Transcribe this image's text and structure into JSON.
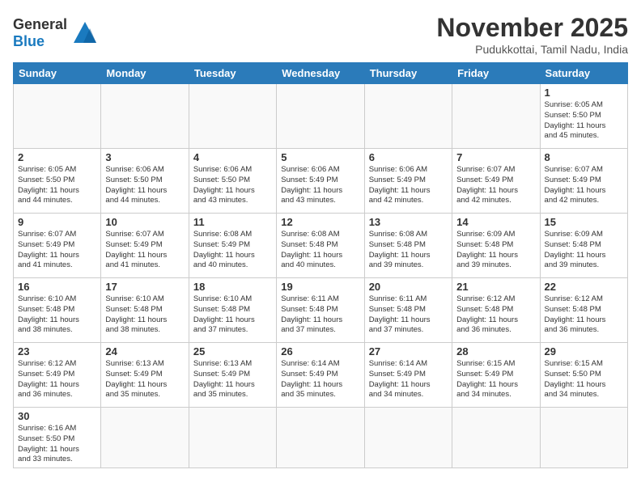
{
  "header": {
    "logo_general": "General",
    "logo_blue": "Blue",
    "month_title": "November 2025",
    "subtitle": "Pudukkottai, Tamil Nadu, India"
  },
  "days_of_week": [
    "Sunday",
    "Monday",
    "Tuesday",
    "Wednesday",
    "Thursday",
    "Friday",
    "Saturday"
  ],
  "weeks": [
    [
      {
        "day": null,
        "info": null
      },
      {
        "day": null,
        "info": null
      },
      {
        "day": null,
        "info": null
      },
      {
        "day": null,
        "info": null
      },
      {
        "day": null,
        "info": null
      },
      {
        "day": null,
        "info": null
      },
      {
        "day": "1",
        "info": "Sunrise: 6:05 AM\nSunset: 5:50 PM\nDaylight: 11 hours\nand 45 minutes."
      }
    ],
    [
      {
        "day": "2",
        "info": "Sunrise: 6:05 AM\nSunset: 5:50 PM\nDaylight: 11 hours\nand 44 minutes."
      },
      {
        "day": "3",
        "info": "Sunrise: 6:06 AM\nSunset: 5:50 PM\nDaylight: 11 hours\nand 44 minutes."
      },
      {
        "day": "4",
        "info": "Sunrise: 6:06 AM\nSunset: 5:50 PM\nDaylight: 11 hours\nand 43 minutes."
      },
      {
        "day": "5",
        "info": "Sunrise: 6:06 AM\nSunset: 5:49 PM\nDaylight: 11 hours\nand 43 minutes."
      },
      {
        "day": "6",
        "info": "Sunrise: 6:06 AM\nSunset: 5:49 PM\nDaylight: 11 hours\nand 42 minutes."
      },
      {
        "day": "7",
        "info": "Sunrise: 6:07 AM\nSunset: 5:49 PM\nDaylight: 11 hours\nand 42 minutes."
      },
      {
        "day": "8",
        "info": "Sunrise: 6:07 AM\nSunset: 5:49 PM\nDaylight: 11 hours\nand 42 minutes."
      }
    ],
    [
      {
        "day": "9",
        "info": "Sunrise: 6:07 AM\nSunset: 5:49 PM\nDaylight: 11 hours\nand 41 minutes."
      },
      {
        "day": "10",
        "info": "Sunrise: 6:07 AM\nSunset: 5:49 PM\nDaylight: 11 hours\nand 41 minutes."
      },
      {
        "day": "11",
        "info": "Sunrise: 6:08 AM\nSunset: 5:49 PM\nDaylight: 11 hours\nand 40 minutes."
      },
      {
        "day": "12",
        "info": "Sunrise: 6:08 AM\nSunset: 5:48 PM\nDaylight: 11 hours\nand 40 minutes."
      },
      {
        "day": "13",
        "info": "Sunrise: 6:08 AM\nSunset: 5:48 PM\nDaylight: 11 hours\nand 39 minutes."
      },
      {
        "day": "14",
        "info": "Sunrise: 6:09 AM\nSunset: 5:48 PM\nDaylight: 11 hours\nand 39 minutes."
      },
      {
        "day": "15",
        "info": "Sunrise: 6:09 AM\nSunset: 5:48 PM\nDaylight: 11 hours\nand 39 minutes."
      }
    ],
    [
      {
        "day": "16",
        "info": "Sunrise: 6:10 AM\nSunset: 5:48 PM\nDaylight: 11 hours\nand 38 minutes."
      },
      {
        "day": "17",
        "info": "Sunrise: 6:10 AM\nSunset: 5:48 PM\nDaylight: 11 hours\nand 38 minutes."
      },
      {
        "day": "18",
        "info": "Sunrise: 6:10 AM\nSunset: 5:48 PM\nDaylight: 11 hours\nand 37 minutes."
      },
      {
        "day": "19",
        "info": "Sunrise: 6:11 AM\nSunset: 5:48 PM\nDaylight: 11 hours\nand 37 minutes."
      },
      {
        "day": "20",
        "info": "Sunrise: 6:11 AM\nSunset: 5:48 PM\nDaylight: 11 hours\nand 37 minutes."
      },
      {
        "day": "21",
        "info": "Sunrise: 6:12 AM\nSunset: 5:48 PM\nDaylight: 11 hours\nand 36 minutes."
      },
      {
        "day": "22",
        "info": "Sunrise: 6:12 AM\nSunset: 5:48 PM\nDaylight: 11 hours\nand 36 minutes."
      }
    ],
    [
      {
        "day": "23",
        "info": "Sunrise: 6:12 AM\nSunset: 5:49 PM\nDaylight: 11 hours\nand 36 minutes."
      },
      {
        "day": "24",
        "info": "Sunrise: 6:13 AM\nSunset: 5:49 PM\nDaylight: 11 hours\nand 35 minutes."
      },
      {
        "day": "25",
        "info": "Sunrise: 6:13 AM\nSunset: 5:49 PM\nDaylight: 11 hours\nand 35 minutes."
      },
      {
        "day": "26",
        "info": "Sunrise: 6:14 AM\nSunset: 5:49 PM\nDaylight: 11 hours\nand 35 minutes."
      },
      {
        "day": "27",
        "info": "Sunrise: 6:14 AM\nSunset: 5:49 PM\nDaylight: 11 hours\nand 34 minutes."
      },
      {
        "day": "28",
        "info": "Sunrise: 6:15 AM\nSunset: 5:49 PM\nDaylight: 11 hours\nand 34 minutes."
      },
      {
        "day": "29",
        "info": "Sunrise: 6:15 AM\nSunset: 5:50 PM\nDaylight: 11 hours\nand 34 minutes."
      }
    ],
    [
      {
        "day": "30",
        "info": "Sunrise: 6:16 AM\nSunset: 5:50 PM\nDaylight: 11 hours\nand 33 minutes."
      },
      {
        "day": null,
        "info": null
      },
      {
        "day": null,
        "info": null
      },
      {
        "day": null,
        "info": null
      },
      {
        "day": null,
        "info": null
      },
      {
        "day": null,
        "info": null
      },
      {
        "day": null,
        "info": null
      }
    ]
  ]
}
